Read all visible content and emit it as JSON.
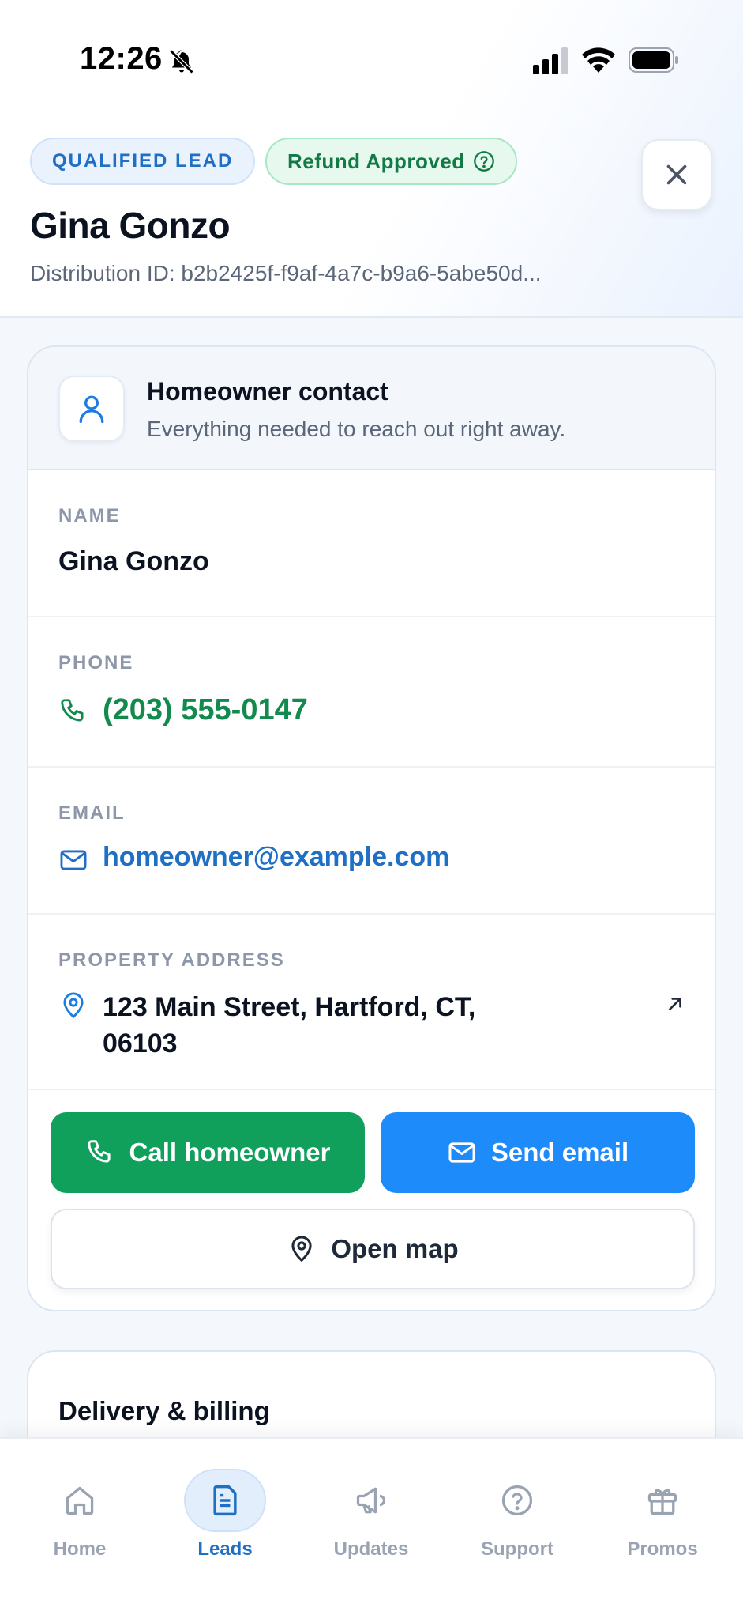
{
  "status_bar": {
    "time": "12:26"
  },
  "header": {
    "badge_qualified": "QUALIFIED LEAD",
    "badge_refund": "Refund Approved",
    "lead_name": "Gina Gonzo",
    "distribution_id": "Distribution ID: b2b2425f-f9af-4a7c-b9a6-5abe50d..."
  },
  "contact_card": {
    "title": "Homeowner contact",
    "subtitle": "Everything needed to reach out right away.",
    "name_label": "NAME",
    "name_value": "Gina Gonzo",
    "phone_label": "PHONE",
    "phone_value": "(203) 555-0147",
    "email_label": "EMAIL",
    "email_value": "homeowner@example.com",
    "address_label": "PROPERTY ADDRESS",
    "address_line1": "123 Main Street, Hartford, CT,",
    "address_line2": "06103",
    "call_button": "Call homeowner",
    "email_button": "Send email",
    "map_button": "Open map"
  },
  "delivery_card": {
    "title": "Delivery & billing"
  },
  "tabbar": {
    "tabs": [
      {
        "label": "Home",
        "icon": "home-icon"
      },
      {
        "label": "Leads",
        "icon": "document-icon",
        "active": true
      },
      {
        "label": "Updates",
        "icon": "megaphone-icon"
      },
      {
        "label": "Support",
        "icon": "help-circle-icon"
      },
      {
        "label": "Promos",
        "icon": "gift-icon"
      }
    ]
  },
  "colors": {
    "accent_blue": "#1e8bfb",
    "accent_green": "#10a05c",
    "phone_green": "#128a4e",
    "link_blue": "#1f6fc5"
  }
}
